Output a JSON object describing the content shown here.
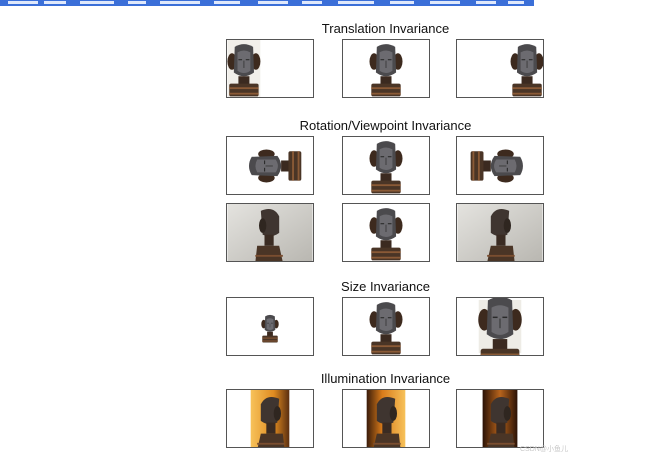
{
  "sections": [
    {
      "title": "Translation Invariance"
    },
    {
      "title": "Rotation/Viewpoint Invariance"
    },
    {
      "title": "Size Invariance"
    },
    {
      "title": "Illumination Invariance"
    }
  ],
  "icons": {
    "figure": "statue-figure-icon"
  },
  "colors": {
    "top_bar": "#3b6fd8",
    "frame_border": "#555555",
    "statue_wood": "#4a3526",
    "statue_face": "#5e5d5f",
    "warm_light": "#f2b24a"
  },
  "watermark": "CSDN@小鱼儿"
}
